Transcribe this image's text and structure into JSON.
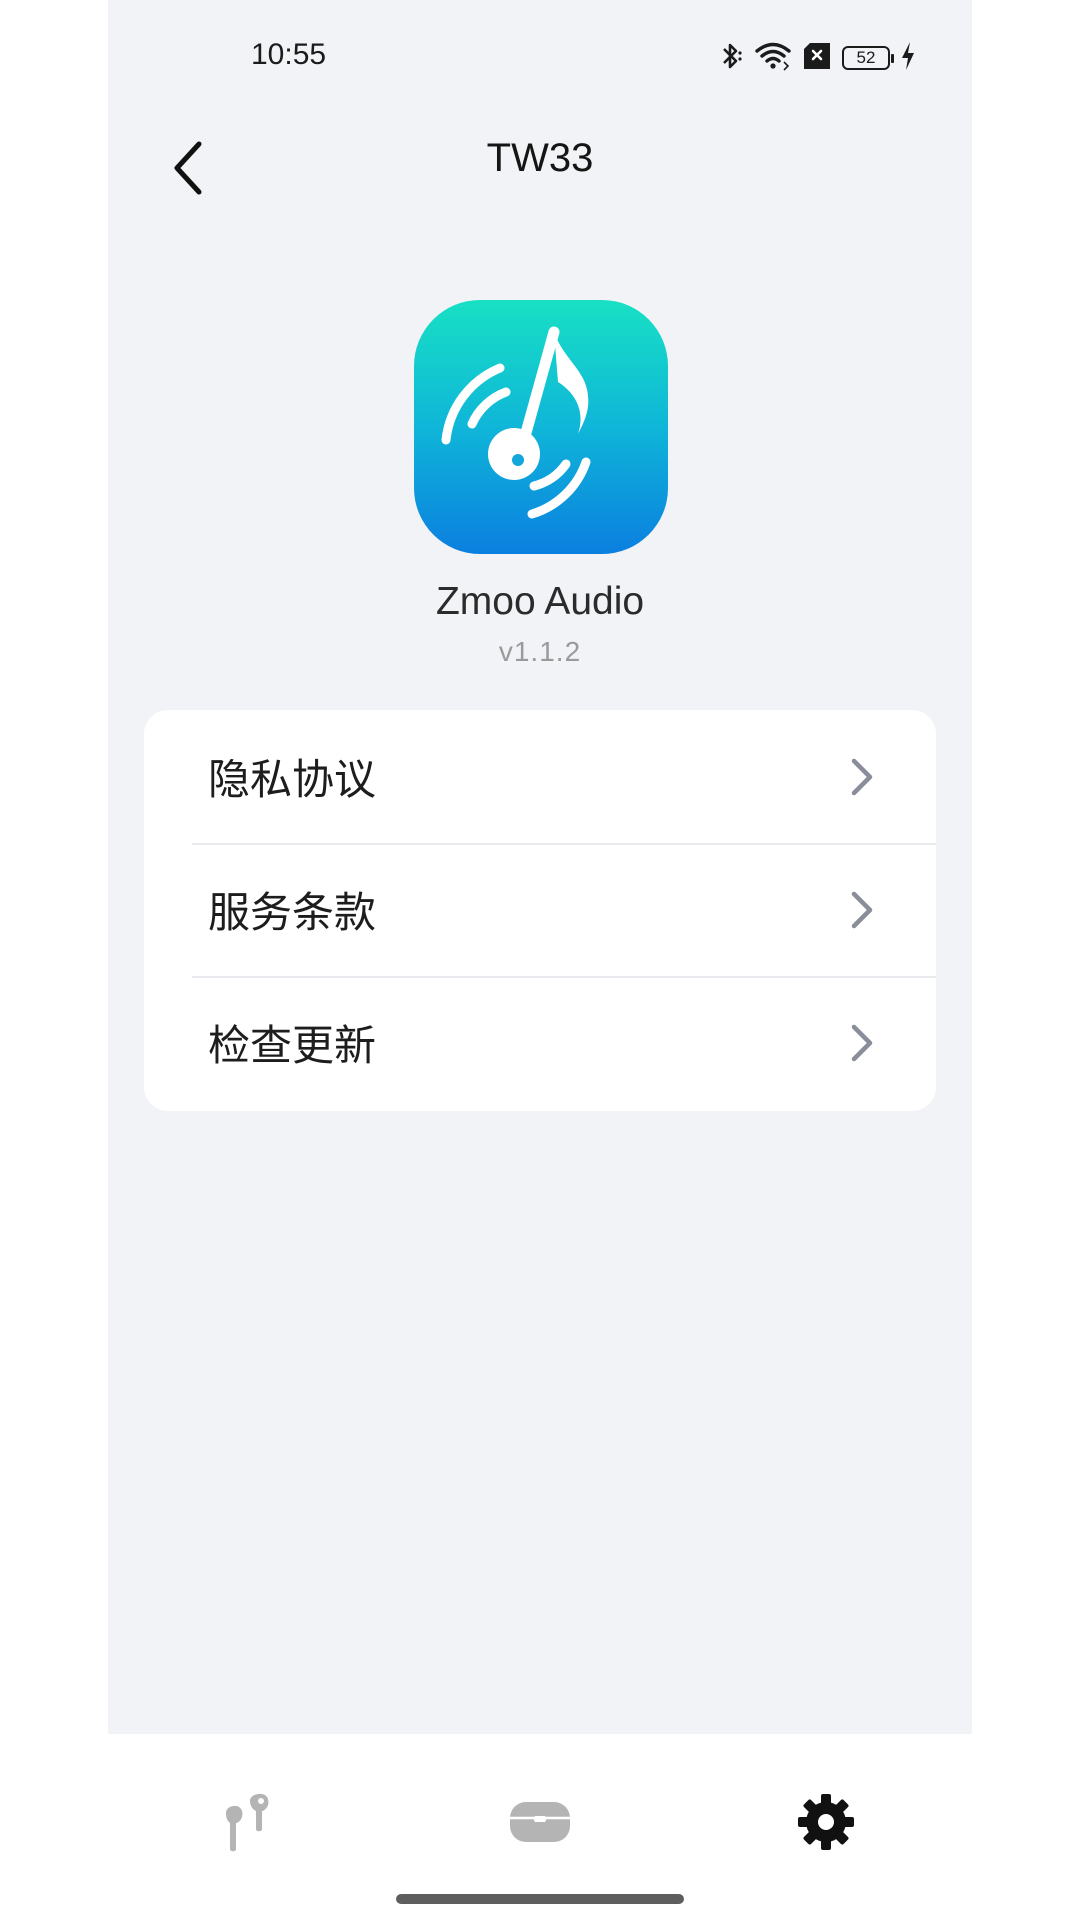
{
  "status_bar": {
    "time": "10:55",
    "battery_level": "52",
    "icons": [
      "bluetooth-icon",
      "wifi-icon",
      "no-sim-icon",
      "battery-icon",
      "charging-icon"
    ]
  },
  "header": {
    "title": "TW33",
    "back_icon": "chevron-left-icon"
  },
  "app": {
    "name": "Zmoo Audio",
    "version": "v1.1.2",
    "icon": "music-note-sound-wave-icon",
    "icon_gradient": [
      "#18e0c4",
      "#0b7fe0"
    ]
  },
  "menu": {
    "items": [
      {
        "label": "隐私协议"
      },
      {
        "label": "服务条款"
      },
      {
        "label": "检查更新"
      }
    ]
  },
  "bottom_nav": {
    "items": [
      {
        "icon": "earbuds-icon",
        "active": false
      },
      {
        "icon": "charging-case-icon",
        "active": false
      },
      {
        "icon": "gear-icon",
        "active": true
      }
    ],
    "active_color": "#111111",
    "inactive_color": "#b4b4b4"
  }
}
